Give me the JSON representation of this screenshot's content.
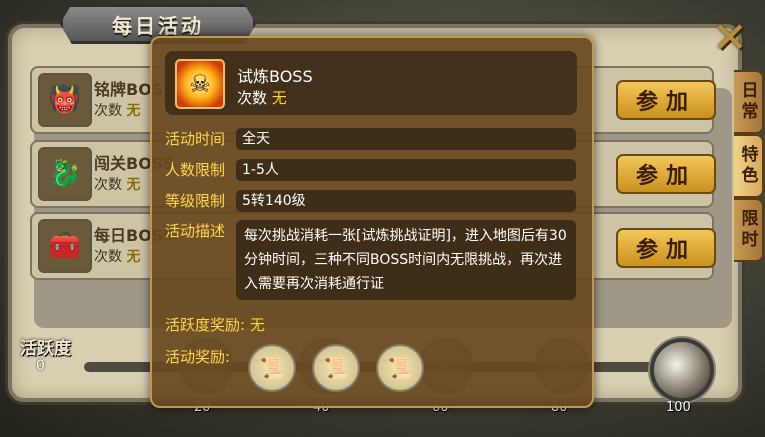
{
  "window": {
    "title": "每日活动",
    "close_label": "✕"
  },
  "side_tabs": [
    {
      "label": "日常",
      "active": false
    },
    {
      "label": "特色",
      "active": true
    },
    {
      "label": "限时",
      "active": false
    }
  ],
  "activities": [
    {
      "name": "铭牌BOSS",
      "count_label": "次数",
      "count_value": "无",
      "join_label": "参加"
    },
    {
      "name": "闯关BOSS",
      "count_label": "次数",
      "count_value": "无",
      "join_label": "参加"
    },
    {
      "name": "每日BOSS",
      "count_label": "次数",
      "count_value": "无",
      "join_label": "参加"
    }
  ],
  "activity_bar": {
    "label": "活跃度",
    "value": "0",
    "ticks": [
      "20",
      "40",
      "60",
      "80",
      "100"
    ]
  },
  "tooltip": {
    "title": "试炼BOSS",
    "count_label": "次数",
    "count_value": "无",
    "fields": [
      {
        "label": "活动时间",
        "value": "全天"
      },
      {
        "label": "人数限制",
        "value": "1-5人"
      },
      {
        "label": "等级限制",
        "value": "5转140级"
      }
    ],
    "desc_label": "活动描述",
    "desc": "每次挑战消耗一张[试炼挑战证明]，进入地图后有30分钟时间，三种不同BOSS时间内无限挑战，再次进入需要再次消耗通行证",
    "activity_reward_label": "活跃度奖励:",
    "activity_reward_value": "无",
    "reward_label": "活动奖励:",
    "reward_items": [
      "scroll-icon",
      "scroll-icon",
      "scroll-icon"
    ]
  },
  "colors": {
    "accent": "#ffd84a",
    "button": "#e6b43a",
    "panel": "#d9d0b2"
  }
}
